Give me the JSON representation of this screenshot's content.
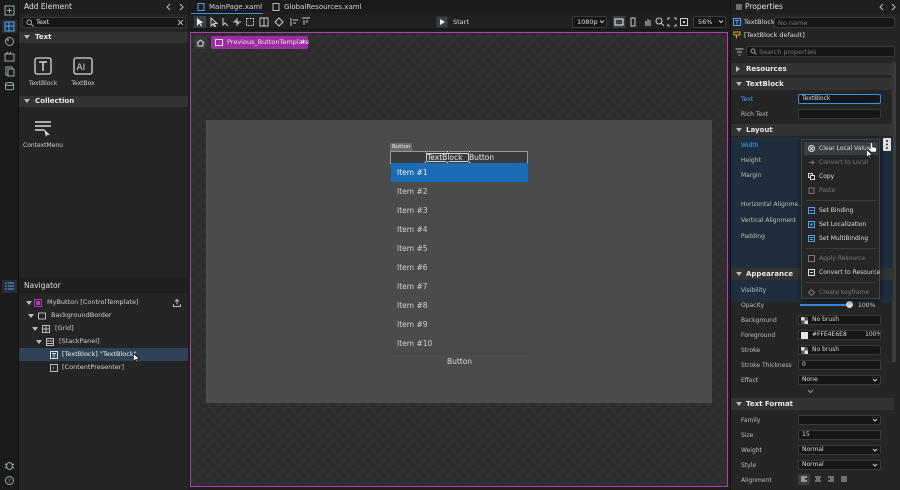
{
  "colors": {
    "accent": "#1a6db5",
    "selection_magenta": "#b33bb5",
    "link_blue": "#4da3ff"
  },
  "add_element": {
    "title": "Add Element",
    "search_value": "Text",
    "sections": [
      {
        "label": "Text",
        "items": [
          {
            "label": "TextBlock",
            "icon": "textblock-icon"
          },
          {
            "label": "TextBox",
            "icon": "textbox-icon"
          }
        ]
      },
      {
        "label": "Collection",
        "items": [
          {
            "label": "ContextMenu",
            "icon": "contextmenu-icon"
          }
        ]
      }
    ]
  },
  "navigator": {
    "title": "Navigator",
    "rows": [
      {
        "label": "MyButton [ControlTemplate]",
        "icon": "template-icon"
      },
      {
        "label": "BackgroundBorder",
        "icon": "border-icon"
      },
      {
        "label": "[Grid]",
        "icon": "grid-icon"
      },
      {
        "label": "[StackPanel]",
        "icon": "stackpanel-icon"
      },
      {
        "label": "[TextBlock] \"TextBlock\"",
        "icon": "textblock-icon"
      },
      {
        "label": "[ContentPresenter]",
        "icon": "contentpresenter-icon"
      }
    ]
  },
  "tabs": [
    {
      "label": "MainPage.xaml"
    },
    {
      "label": "GlobalResources.xaml"
    }
  ],
  "toolbar": {
    "start_label": "Start",
    "resolution": "1080p",
    "zoom": "56%"
  },
  "canvas": {
    "breadcrumb": "Previous_ButtonTemplate",
    "adorner_label": "Button",
    "button_text_1": "TextBlock",
    "button_text_2": "Button",
    "items": [
      "Item #1",
      "Item #2",
      "Item #3",
      "Item #4",
      "Item #5",
      "Item #6",
      "Item #7",
      "Item #8",
      "Item #9",
      "Item #10"
    ],
    "footer_button": "Button"
  },
  "properties": {
    "title": "Properties",
    "element_type": "TextBlock",
    "name_placeholder": "No name",
    "style_label": "[TextBlock default]",
    "search_placeholder": "Search properties",
    "sections": {
      "resources": "Resources",
      "textblock": "TextBlock",
      "layout": "Layout",
      "appearance": "Appearance",
      "text_format": "Text Format"
    },
    "text_label": "Text",
    "text_value": "TextBlock",
    "rich_text_label": "Rich Text",
    "layout_labels": {
      "width": "Width",
      "height": "Height",
      "margin": "Margin",
      "halign": "Horizontal Alignme...",
      "valign": "Vertical Alignment",
      "padding": "Padding"
    },
    "appearance": {
      "visibility": "Visibility",
      "opacity": "Opacity",
      "opacity_value": "100%",
      "opacity_level": 1.0,
      "background": "Background",
      "background_value": "No brush",
      "foreground": "Foreground",
      "foreground_value": "#FFE4E6E8",
      "foreground_opacity": "100%",
      "stroke": "Stroke",
      "stroke_value": "No brush",
      "stroke_thickness": "Stroke Thickness",
      "stroke_thickness_value": "0",
      "effect": "Effect",
      "effect_value": "None"
    },
    "text_format": {
      "family": "Family",
      "size": "Size",
      "size_value": "15",
      "weight": "Weight",
      "weight_value": "Normal",
      "style": "Style",
      "style_value": "Normal",
      "alignment": "Alignment"
    }
  },
  "context_menu": {
    "items": [
      {
        "label": "Clear Local Value",
        "disabled": false
      },
      {
        "label": "Convert to Local",
        "disabled": true
      },
      {
        "label": "Copy",
        "disabled": false
      },
      {
        "label": "Paste",
        "disabled": true
      },
      {
        "label": "Set Binding",
        "disabled": false
      },
      {
        "label": "Set Localization",
        "disabled": false
      },
      {
        "label": "Set MultiBinding",
        "disabled": false
      },
      {
        "label": "Apply Resource",
        "disabled": true
      },
      {
        "label": "Convert to Resource",
        "disabled": false
      },
      {
        "label": "Create keyframe",
        "disabled": true
      }
    ]
  }
}
